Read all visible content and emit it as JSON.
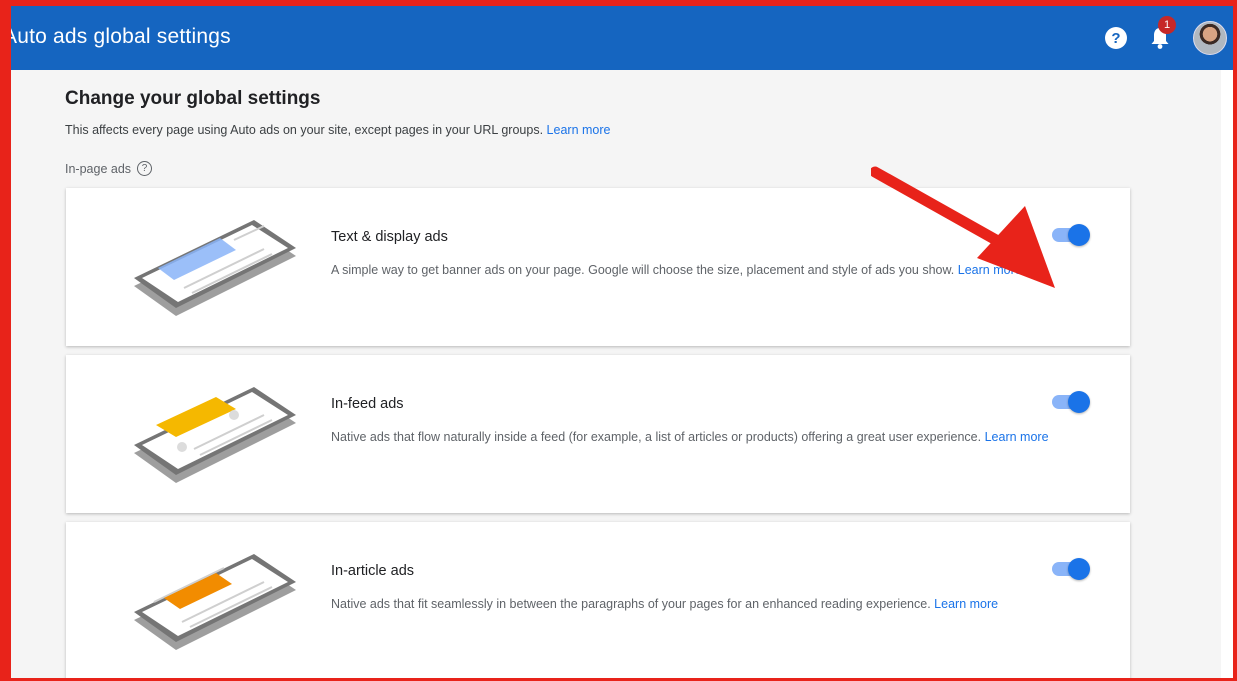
{
  "appbar": {
    "title": "Auto ads global settings",
    "help_icon": "help-icon",
    "notification_count": "1",
    "accent_color": "#1565c0"
  },
  "page": {
    "title": "Change your global settings",
    "description": "This affects every page using Auto ads on your site, except pages in your URL groups.",
    "description_link": "Learn more",
    "section_label": "In-page ads"
  },
  "cards": [
    {
      "title": "Text & display ads",
      "description": "A simple way to get banner ads on your page. Google will choose the size, placement and style of ads you show.",
      "link": "Learn more",
      "enabled": true,
      "illustration_color": "#8ab4f8"
    },
    {
      "title": "In-feed ads",
      "description": "Native ads that flow naturally inside a feed (for example, a list of articles or products) offering a great user experience.",
      "link": "Learn more",
      "enabled": true,
      "illustration_color": "#f5b800"
    },
    {
      "title": "In-article ads",
      "description": "Native ads that fit seamlessly in between the paragraphs of your pages for an enhanced reading experience.",
      "link": "Learn more",
      "enabled": true,
      "illustration_color": "#f28c00"
    }
  ],
  "colors": {
    "frame": "#e8231a",
    "toggle_on": "#1a73e8",
    "link": "#1a73e8",
    "annotation_arrow": "#e8231a"
  }
}
